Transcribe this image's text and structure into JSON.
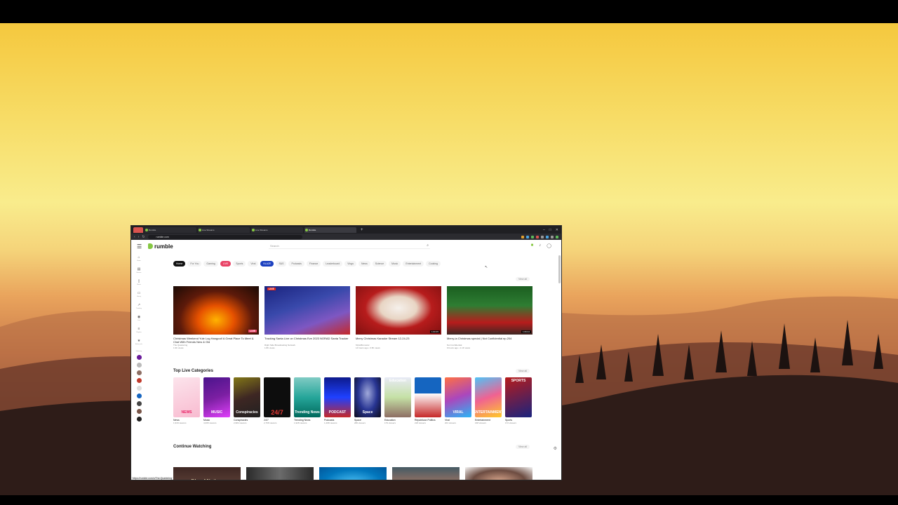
{
  "tabs": [
    {
      "label": "Rumble",
      "active": false
    },
    {
      "label": "Rumble",
      "active": false
    },
    {
      "label": "Live Streams",
      "active": false
    },
    {
      "label": "Live Streams",
      "active": false
    },
    {
      "label": "Rumble",
      "active": true
    }
  ],
  "address": {
    "url": "rumble.com"
  },
  "header": {
    "logo": "rumble",
    "search_placeholder": "Search"
  },
  "sidebar": [
    {
      "icon": "home-icon",
      "label": "Home"
    },
    {
      "icon": "browse-icon",
      "label": "Browse"
    },
    {
      "icon": "shorts-icon",
      "label": "Shorts"
    },
    {
      "icon": "library-icon",
      "label": "Library"
    },
    {
      "icon": "trending-icon",
      "label": "Trending"
    },
    {
      "icon": "live-icon",
      "label": "Live"
    },
    {
      "icon": "playlists-icon",
      "label": "Playlists"
    },
    {
      "icon": "editor-icon",
      "label": "Editor picks"
    }
  ],
  "sidebar_following_label": "Following",
  "chips": [
    "Home",
    "For You",
    "Gaming",
    "LIVE",
    "Sports",
    "Viral",
    "BLAZE",
    "S&S",
    "Podcasts",
    "Finance",
    "Leaderboard",
    "Vlogs",
    "News",
    "Science",
    "Music",
    "Entertainment",
    "Cooking"
  ],
  "featured": {
    "view_all": "View all",
    "videos": [
      {
        "title": "Christmas Weekend Yule Log Hangout! A Great Place To Meet & Chat With Friends New & Old",
        "channel": "The Quartering",
        "views": "1.9K views",
        "badge": "LIVE",
        "duration": ""
      },
      {
        "title": "Tracking Santa Live on Christmas Eve 2023 NORAD Santa Tracker",
        "channel": "Right Side Broadcasting Network",
        "views": "1.8K views",
        "badge": "LIVE",
        "duration": ""
      },
      {
        "title": "Merry Christmas Karaoke Stream 12-24-23",
        "channel": "MyhoBrumotor",
        "views": "14 hours ago • 3.5K views",
        "badge": "",
        "duration": "1:00:45"
      },
      {
        "title": "Merry-ia Christmas special | Not Confidential ep.204",
        "channel": "Not Confidential",
        "views": "9 hours ago • 1.1K views",
        "badge": "",
        "duration": "1:09:44"
      }
    ]
  },
  "top_live_categories": {
    "title": "Top Live Categories",
    "view_all": "View all",
    "items": [
      {
        "name": "News",
        "viewers": "1,918 viewers",
        "art": "NEWS"
      },
      {
        "name": "Music",
        "viewers": "4,095 viewers",
        "art": "MUSIC"
      },
      {
        "name": "Conspiracies",
        "viewers": "2,984 viewers",
        "art": "Conspiracies"
      },
      {
        "name": "24/7",
        "viewers": "2,768 viewers",
        "art": "24/7"
      },
      {
        "name": "Trending News",
        "viewers": "1,928 viewers",
        "art": "Trending News"
      },
      {
        "name": "Podcasts",
        "viewers": "1,298 viewers",
        "art": "PODCAST"
      },
      {
        "name": "Space",
        "viewers": "286 viewers",
        "art": "Space"
      },
      {
        "name": "Education",
        "viewers": "179 viewers",
        "art": "Education"
      },
      {
        "name": "Republican Politics",
        "viewers": "218 viewers",
        "art": ""
      },
      {
        "name": "Viral",
        "viewers": "201 viewers",
        "art": "VIRAL"
      },
      {
        "name": "Entertainment",
        "viewers": "168 viewers",
        "art": "ENTERTAINMENT"
      },
      {
        "name": "Sports",
        "viewers": "172 viewers",
        "art": "SPORTS"
      }
    ]
  },
  "continue_watching": {
    "title": "Continue Watching",
    "view_all": "View all",
    "thumb_text": "Rise of Nations"
  },
  "status_url": "https://rumble.com/c/The-Quartering"
}
